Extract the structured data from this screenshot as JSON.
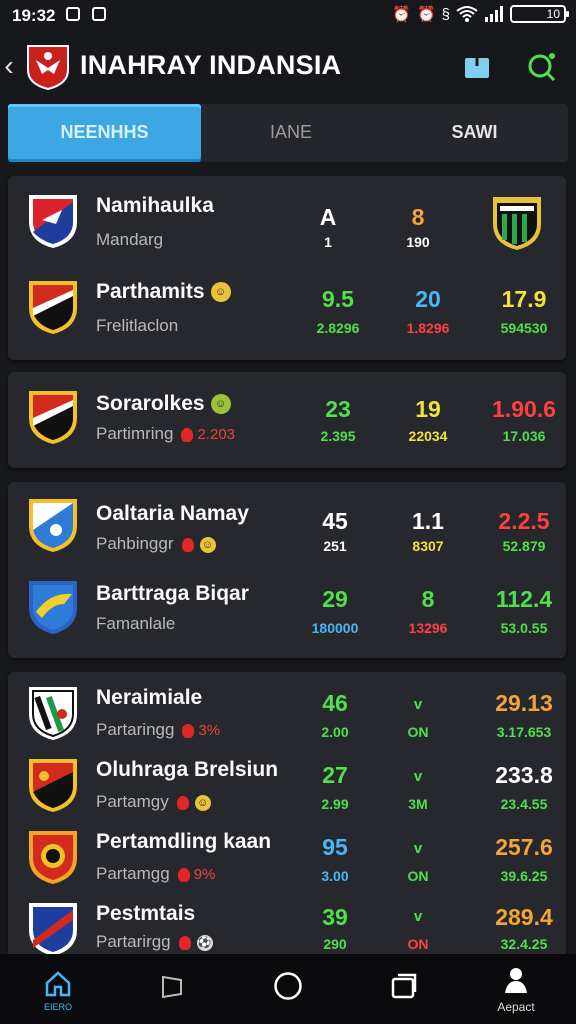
{
  "status": {
    "time": "19:32",
    "battery": "10"
  },
  "header": {
    "title": "INAHRAY INDANSIA"
  },
  "tabs": [
    {
      "label": "NEENHHS"
    },
    {
      "label": "IANE"
    },
    {
      "label": "SAWI"
    }
  ],
  "cards": [
    {
      "rows": [
        {
          "name": "Namihaulka",
          "sub": "Mandarg",
          "v1": "A",
          "v1s": "1",
          "v2": "8",
          "v2s": "190",
          "v3": "",
          "v3s": ""
        },
        {
          "name": "Parthamits",
          "sub": "Frelitlaclon",
          "v1": "9.5",
          "v1s": "2.8296",
          "v2": "20",
          "v2s": "1.8296",
          "v3": "17.9",
          "v3s": "594530"
        }
      ]
    },
    {
      "rows": [
        {
          "name": "Sorarolkes",
          "sub": "Partimring",
          "sub_extra": "2.203",
          "v1": "23",
          "v1s": "2.395",
          "v2": "19",
          "v2s": "22034",
          "v3": "1.90.6",
          "v3s": "17.036"
        }
      ]
    },
    {
      "rows": [
        {
          "name": "Oaltaria Namay",
          "sub": "Pahbinggr",
          "v1": "45",
          "v1s": "251",
          "v2": "1.1",
          "v2s": "8307",
          "v3": "2.2.5",
          "v3s": "52.879"
        },
        {
          "name": "Barttraga Biqar",
          "sub": "Famanlale",
          "v1": "29",
          "v1s": "180000",
          "v2": "8",
          "v2s": "13296",
          "v3": "112.4",
          "v3s": "53.0.55"
        }
      ]
    },
    {
      "rows": [
        {
          "name": "Neraimiale",
          "sub": "Partaringg",
          "sub_extra": "3%",
          "v1": "46",
          "v1s": "2.00",
          "v2": "v",
          "v2s": "ON",
          "v3": "29.13",
          "v3s": "3.17.653"
        },
        {
          "name": "Oluhraga Brelsiun",
          "sub": "Partamgy",
          "v1": "27",
          "v1s": "2.99",
          "v2": "v",
          "v2s": "3M",
          "v3": "233.8",
          "v3s": "23.4.55"
        },
        {
          "name": "Pertamdling kaan",
          "sub": "Partamgg",
          "sub_extra": "9%",
          "v1": "95",
          "v1s": "3.00",
          "v2": "v",
          "v2s": "ON",
          "v3": "257.6",
          "v3s": "39.6.25"
        },
        {
          "name": "Pestmtais",
          "sub": "Partarirgg",
          "v1": "39",
          "v1s": "290",
          "v2": "v",
          "v2s": "ON",
          "v3": "289.4",
          "v3s": "32.4.25"
        }
      ]
    }
  ],
  "nav": [
    {
      "label": "EIERO",
      "icon": "home-icon"
    },
    {
      "label": "",
      "icon": "back-triangle-icon"
    },
    {
      "label": "",
      "icon": "home-circle-icon"
    },
    {
      "label": "",
      "icon": "recents-icon"
    },
    {
      "label": "Aepact",
      "icon": "user-icon"
    }
  ]
}
